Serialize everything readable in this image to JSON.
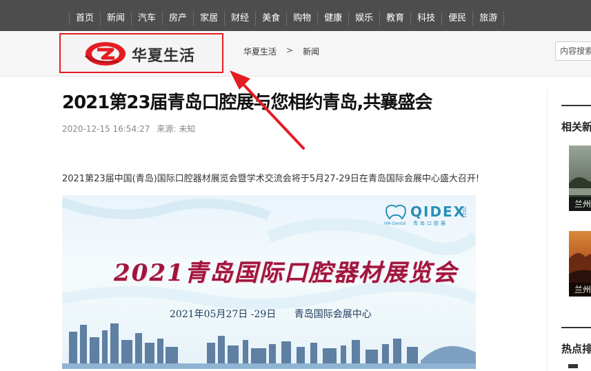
{
  "nav": {
    "items": [
      "首页",
      "新闻",
      "汽车",
      "房产",
      "家居",
      "财经",
      "美食",
      "购物",
      "健康",
      "娱乐",
      "教育",
      "科技",
      "便民",
      "旅游"
    ]
  },
  "header": {
    "logo_text": "华夏生活",
    "breadcrumb": {
      "home": "华夏生活",
      "separator": ">",
      "current": "新闻"
    },
    "search_placeholder": "内容搜索"
  },
  "article": {
    "title": "2021第23届青岛口腔展与您相约青岛,共襄盛会",
    "date": "2020-12-15 16:54:27",
    "source": "来源: 未知",
    "paragraph": "2021第23届中国(青岛)国际口腔器材展览会暨学术交流会将于5月27-29日在青岛国际会展中心盛大召开!",
    "poster": {
      "headline": "2021青岛国际口腔器材展览会",
      "date_text": "2021年05月27日 -29日",
      "venue_text": "青岛国际会展中心",
      "logo_text": "QIDEX",
      "logo_sub": "青岛口腔展",
      "logo_brand": "HM-Dental",
      "logo_year": "2021"
    }
  },
  "sidebar": {
    "related_heading": "相关新闻",
    "related_items": [
      "兰州",
      "兰州"
    ],
    "hot_heading": "热点排行"
  },
  "colors": {
    "nav_bg": "#4d4d4d",
    "brand_red": "#e51c23",
    "poster_title": "#a0153e",
    "header_bg": "#f6f6f6"
  },
  "annotation": {
    "type": "arrow",
    "color": "#e51c23",
    "points_to": "logo"
  }
}
